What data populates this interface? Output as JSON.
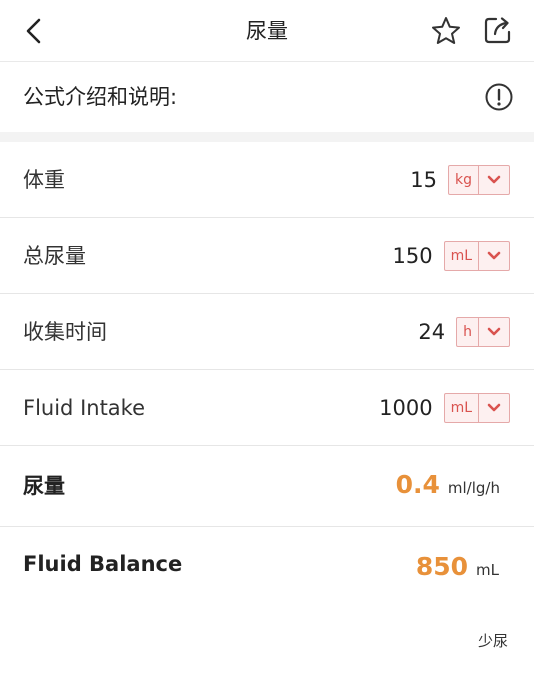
{
  "header": {
    "title": "尿量",
    "back_icon": "chevron-left-icon",
    "favorite_icon": "star-icon",
    "share_icon": "share-icon"
  },
  "intro": {
    "label": "公式介绍和说明:",
    "info_icon": "info-icon"
  },
  "inputs": [
    {
      "label": "体重",
      "value": "15",
      "unit": "kg"
    },
    {
      "label": "总尿量",
      "value": "150",
      "unit": "mL"
    },
    {
      "label": "收集时间",
      "value": "24",
      "unit": "h"
    },
    {
      "label": "Fluid Intake",
      "value": "1000",
      "unit": "mL"
    }
  ],
  "results": [
    {
      "label": "尿量",
      "value": "0.4",
      "unit": "ml/lg/h"
    },
    {
      "label": "Fluid Balance",
      "value": "850",
      "unit": "mL"
    }
  ],
  "footnote": "少尿",
  "colors": {
    "accent": "#e8913a",
    "unit_border": "#e5a9a9",
    "unit_bg": "#fdf0f0",
    "unit_text": "#d9534f"
  }
}
